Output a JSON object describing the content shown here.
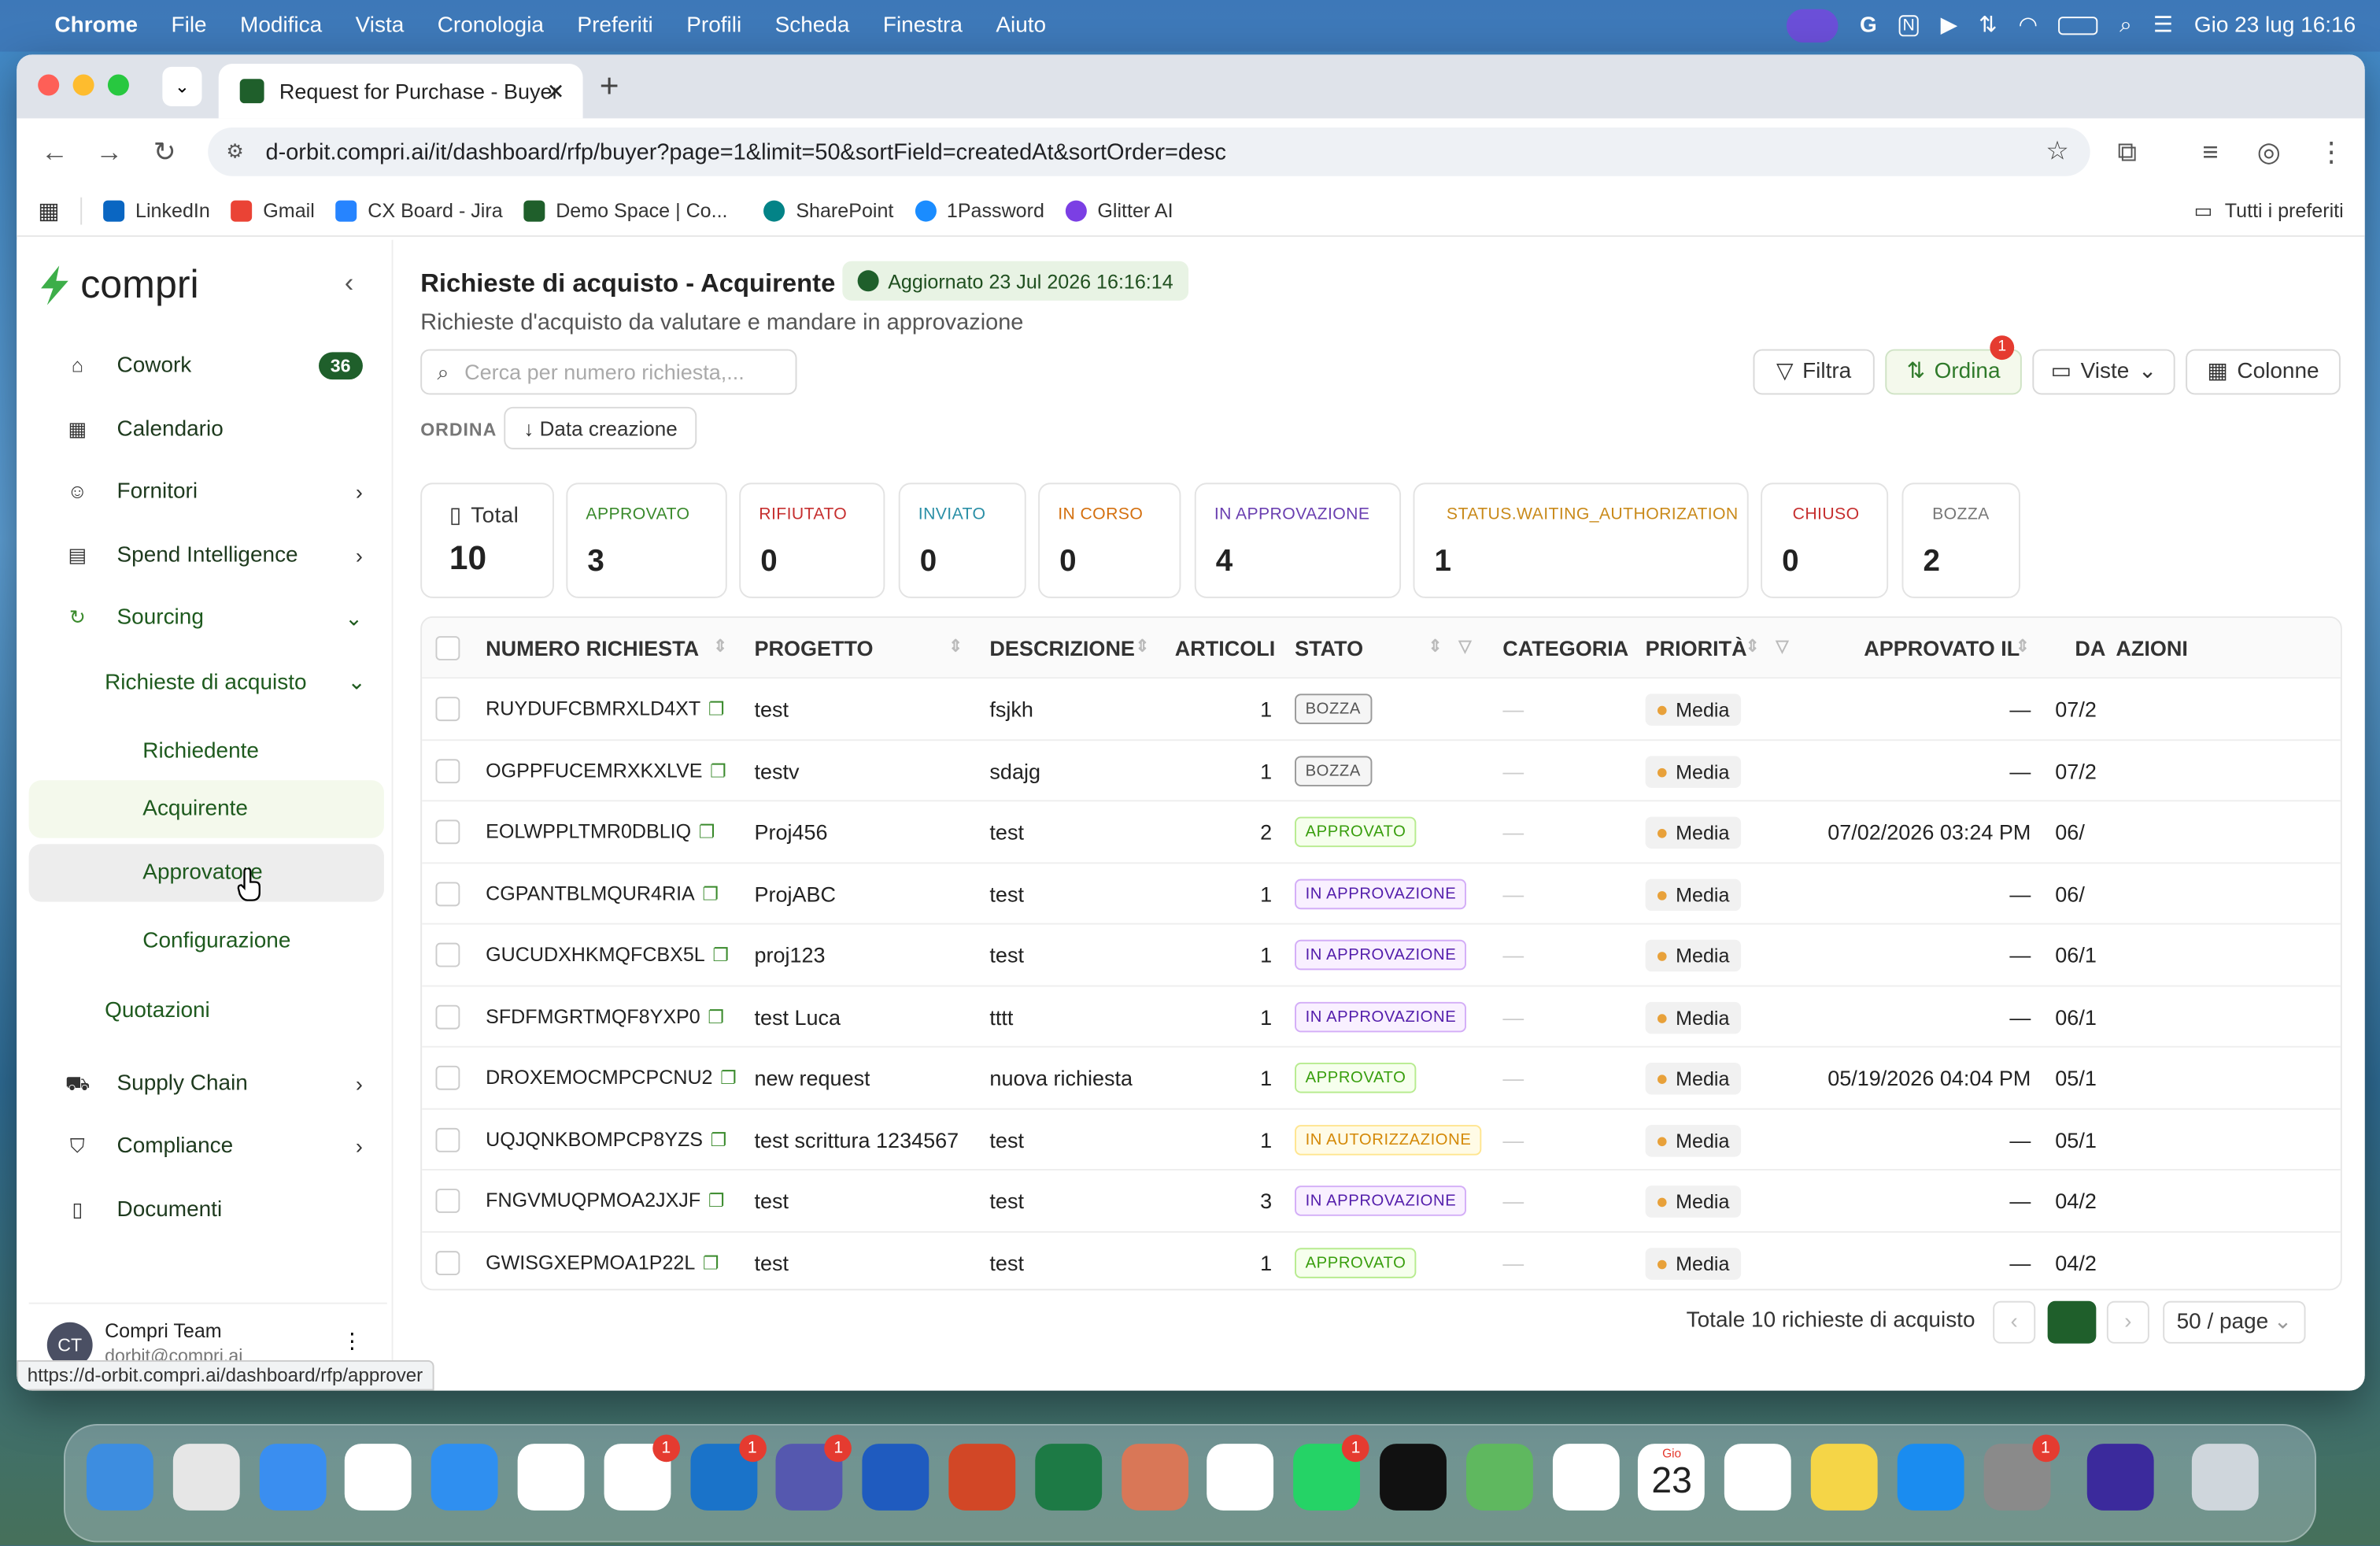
{
  "menubar": {
    "app": "Chrome",
    "items": [
      "File",
      "Modifica",
      "Vista",
      "Cronologia",
      "Preferiti",
      "Profili",
      "Scheda",
      "Finestra",
      "Aiuto"
    ],
    "datetime": "Gio 23 lug  16:16"
  },
  "browser": {
    "tab_title": "Request for Purchase - Buyer",
    "url": "d-orbit.compri.ai/it/dashboard/rfp/buyer?page=1&limit=50&sortField=createdAt&sortOrder=desc",
    "bookmarks": [
      {
        "label": "LinkedIn",
        "color": "#0a66c2"
      },
      {
        "label": "Gmail",
        "color": "#ea4335"
      },
      {
        "label": "CX Board - Jira",
        "color": "#2684ff"
      },
      {
        "label": "Demo Space | Co...",
        "color": "#1f5f2b"
      },
      {
        "label": "SharePoint",
        "color": "#038387"
      },
      {
        "label": "1Password",
        "color": "#1a8cff"
      },
      {
        "label": "Glitter AI",
        "color": "#7b3fe4"
      }
    ],
    "all_bookmarks": "Tutti i preferiti",
    "status_url": "https://d-orbit.compri.ai/dashboard/rfp/approver"
  },
  "sidebar": {
    "logo": "compri",
    "items": [
      {
        "label": "Cowork",
        "badge": "36",
        "icon": "home-icon"
      },
      {
        "label": "Calendario",
        "icon": "calendar-icon"
      },
      {
        "label": "Fornitori",
        "icon": "suppliers-icon"
      },
      {
        "label": "Spend Intelligence",
        "icon": "chart-icon"
      },
      {
        "label": "Sourcing",
        "icon": "refresh-icon"
      },
      {
        "label": "Supply Chain",
        "icon": "truck-icon"
      },
      {
        "label": "Compliance",
        "icon": "shield-icon"
      },
      {
        "label": "Documenti",
        "icon": "document-icon"
      }
    ],
    "sourcing_sub": {
      "group": "Richieste di acquisto",
      "children": [
        "Richiedente",
        "Acquirente",
        "Approvatore",
        "Configurazione"
      ],
      "quotazioni": "Quotazioni"
    },
    "user": {
      "initials": "CT",
      "name": "Compri Team",
      "email": "dorbit@compri.ai"
    }
  },
  "header": {
    "title": "Richieste di acquisto - Acquirente",
    "updated": "Aggiornato 23 Jul 2026 16:16:14",
    "subtitle": "Richieste d'acquisto da valutare e mandare in approvazione",
    "search_placeholder": "Cerca per numero richiesta,...",
    "filter": "Filtra",
    "sort": "Ordina",
    "sort_badge": "1",
    "views": "Viste",
    "columns": "Colonne",
    "sort_label": "ORDINA",
    "sort_chip": "↓ Data creazione"
  },
  "stats": [
    {
      "label": "Total",
      "value": "10",
      "color": "#222"
    },
    {
      "label": "APPROVATO",
      "value": "3",
      "color": "#3a8a2c"
    },
    {
      "label": "RIFIUTATO",
      "value": "0",
      "color": "#c62f2f"
    },
    {
      "label": "INVIATO",
      "value": "0",
      "color": "#2a8fa6"
    },
    {
      "label": "IN CORSO",
      "value": "0",
      "color": "#d4700f"
    },
    {
      "label": "IN APPROVAZIONE",
      "value": "4",
      "color": "#6a3fb0"
    },
    {
      "label": "STATUS.WAITING_AUTHORIZATION",
      "value": "1",
      "color": "#c98a1a"
    },
    {
      "label": "CHIUSO",
      "value": "0",
      "color": "#c62f2f"
    },
    {
      "label": "BOZZA",
      "value": "2",
      "color": "#777"
    }
  ],
  "table": {
    "headers": [
      "NUMERO RICHIESTA",
      "PROGETTO",
      "DESCRIZIONE",
      "ARTICOLI",
      "STATO",
      "CATEGORIA",
      "PRIORITÀ",
      "APPROVATO IL",
      "DA",
      "AZIONI"
    ],
    "rows": [
      {
        "id": "RUYDUFCBMRXLD4XT",
        "project": "test",
        "desc": "fsjkh",
        "items": "1",
        "status": "BOZZA",
        "cat": "—",
        "prio": "Media",
        "approved": "—",
        "date": "07/2"
      },
      {
        "id": "OGPPFUCEMRXKXLVE",
        "project": "testv",
        "desc": "sdajg",
        "items": "1",
        "status": "BOZZA",
        "cat": "—",
        "prio": "Media",
        "approved": "—",
        "date": "07/2"
      },
      {
        "id": "EOLWPPLTMR0DBLIQ",
        "project": "Proj456",
        "desc": "test",
        "items": "2",
        "status": "APPROVATO",
        "cat": "—",
        "prio": "Media",
        "approved": "07/02/2026 03:24 PM",
        "date": "06/"
      },
      {
        "id": "CGPANTBLMQUR4RIA",
        "project": "ProjABC",
        "desc": "test",
        "items": "1",
        "status": "IN APPROVAZIONE",
        "cat": "—",
        "prio": "Media",
        "approved": "—",
        "date": "06/"
      },
      {
        "id": "GUCUDXHKMQFCBX5L",
        "project": "proj123",
        "desc": "test",
        "items": "1",
        "status": "IN APPROVAZIONE",
        "cat": "—",
        "prio": "Media",
        "approved": "—",
        "date": "06/1"
      },
      {
        "id": "SFDFMGRTMQF8YXP0",
        "project": "test Luca",
        "desc": "tttt",
        "items": "1",
        "status": "IN APPROVAZIONE",
        "cat": "—",
        "prio": "Media",
        "approved": "—",
        "date": "06/1"
      },
      {
        "id": "DROXEMOCMPCPCNU2",
        "project": "new request",
        "desc": "nuova richiesta",
        "items": "1",
        "status": "APPROVATO",
        "cat": "—",
        "prio": "Media",
        "approved": "05/19/2026 04:04 PM",
        "date": "05/1"
      },
      {
        "id": "UQJQNKBOMPCP8YZS",
        "project": "test scrittura 1234567",
        "desc": "test",
        "items": "1",
        "status": "IN AUTORIZZAZIONE",
        "cat": "—",
        "prio": "Media",
        "approved": "—",
        "date": "05/1"
      },
      {
        "id": "FNGVMUQPMOA2JXJF",
        "project": "test",
        "desc": "test",
        "items": "3",
        "status": "IN APPROVAZIONE",
        "cat": "—",
        "prio": "Media",
        "approved": "—",
        "date": "04/2"
      },
      {
        "id": "GWISGXEPMOA1P22L",
        "project": "test",
        "desc": "test",
        "items": "1",
        "status": "APPROVATO",
        "cat": "—",
        "prio": "Media",
        "approved": "—",
        "date": "04/2"
      }
    ]
  },
  "pagination": {
    "total": "Totale 10 richieste di acquisto",
    "page_size": "50 / page"
  },
  "dock": {
    "calendar_month": "Gio",
    "calendar_day": "23"
  }
}
